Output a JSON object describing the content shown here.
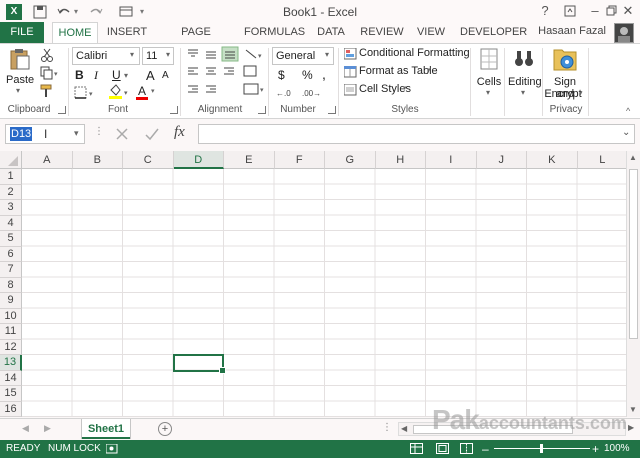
{
  "window": {
    "title": "Book1 - Excel",
    "minimize": "–",
    "close": "✕",
    "help": "?"
  },
  "tabs": [
    {
      "label": "FILE"
    },
    {
      "label": "HOME"
    },
    {
      "label": "INSERT"
    },
    {
      "label": "PAGE LAYOUT"
    },
    {
      "label": "FORMULAS"
    },
    {
      "label": "DATA"
    },
    {
      "label": "REVIEW"
    },
    {
      "label": "VIEW"
    },
    {
      "label": "DEVELOPER"
    }
  ],
  "user": {
    "name": "Hasaan Fazal"
  },
  "ribbon": {
    "clipboard": {
      "label": "Clipboard",
      "paste": "Paste"
    },
    "font": {
      "label": "Font",
      "family": "Calibri",
      "size": "11",
      "bold": "B",
      "italic": "I",
      "underline": "U",
      "grow": "A",
      "shrink": "A",
      "color_a": "A"
    },
    "alignment": {
      "label": "Alignment"
    },
    "number": {
      "label": "Number",
      "format": "General",
      "currency": "$",
      "percent": "%",
      "comma": ","
    },
    "styles": {
      "label": "Styles",
      "conditional": "Conditional Formatting",
      "table": "Format as Table",
      "cell_styles": "Cell Styles"
    },
    "cells": {
      "label": "Cells"
    },
    "editing": {
      "label": "Editing"
    },
    "privacy": {
      "label": "Privacy",
      "sign_line1": "Sign and",
      "sign_line2": "Encrypt"
    }
  },
  "formula_bar": {
    "name_box": "D13",
    "fx": "fx",
    "value": ""
  },
  "grid": {
    "columns": [
      "A",
      "B",
      "C",
      "D",
      "E",
      "F",
      "G",
      "H",
      "I",
      "J",
      "K",
      "L"
    ],
    "rows": [
      "1",
      "2",
      "3",
      "4",
      "5",
      "6",
      "7",
      "8",
      "9",
      "10",
      "11",
      "12",
      "13",
      "14",
      "15",
      "16"
    ],
    "active_column": "D",
    "active_row": "13"
  },
  "sheets": {
    "active": "Sheet1",
    "add": "+"
  },
  "status": {
    "ready": "READY",
    "numlock": "NUM LOCK",
    "zoom": "100%"
  },
  "watermark": {
    "bold": "Pak",
    "rest": "accountants.com"
  },
  "colors": {
    "accent": "#217346",
    "selection": "#2a6ac8"
  }
}
